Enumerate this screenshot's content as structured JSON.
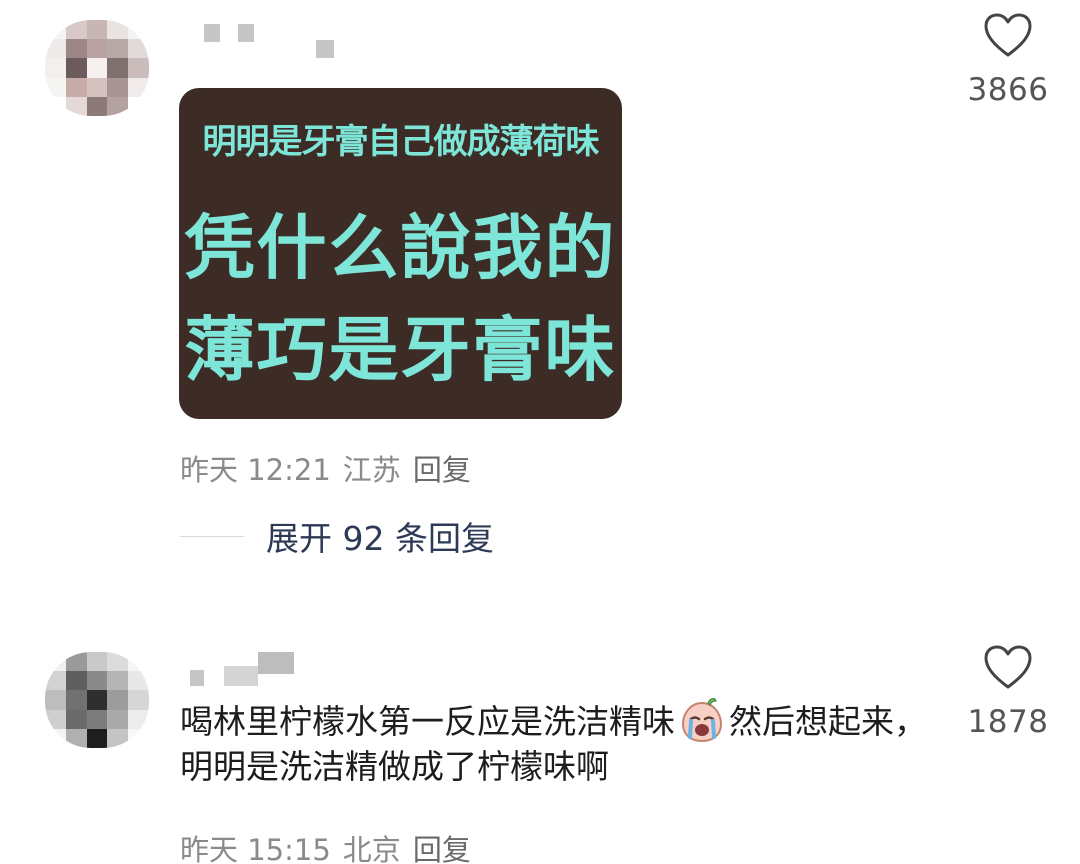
{
  "comments": [
    {
      "sticker": {
        "line1": "明明是牙膏自己做成薄荷味",
        "line2": "凭什么說我的",
        "line3": "薄巧是牙膏味"
      },
      "like_count": "3866",
      "time": "昨天 12:21",
      "location": "江苏",
      "reply_label": "回复",
      "expand_replies": "展开 92 条回复"
    },
    {
      "text_part1": "喝林里柠檬水第一反应是洗洁精味",
      "emoji": "crying-face-emoji",
      "text_part2": "然后想起来，明明是洗洁精做成了柠檬味啊",
      "like_count": "1878",
      "time": "昨天 15:15",
      "location": "北京",
      "reply_label": "回复"
    }
  ],
  "icons": {
    "like": "heart-outline-icon"
  },
  "colors": {
    "sticker_bg": "#3d2c26",
    "sticker_text": "#7ee6d8",
    "meta_text": "#8a8a8a",
    "expand_link": "#2d3a55"
  }
}
